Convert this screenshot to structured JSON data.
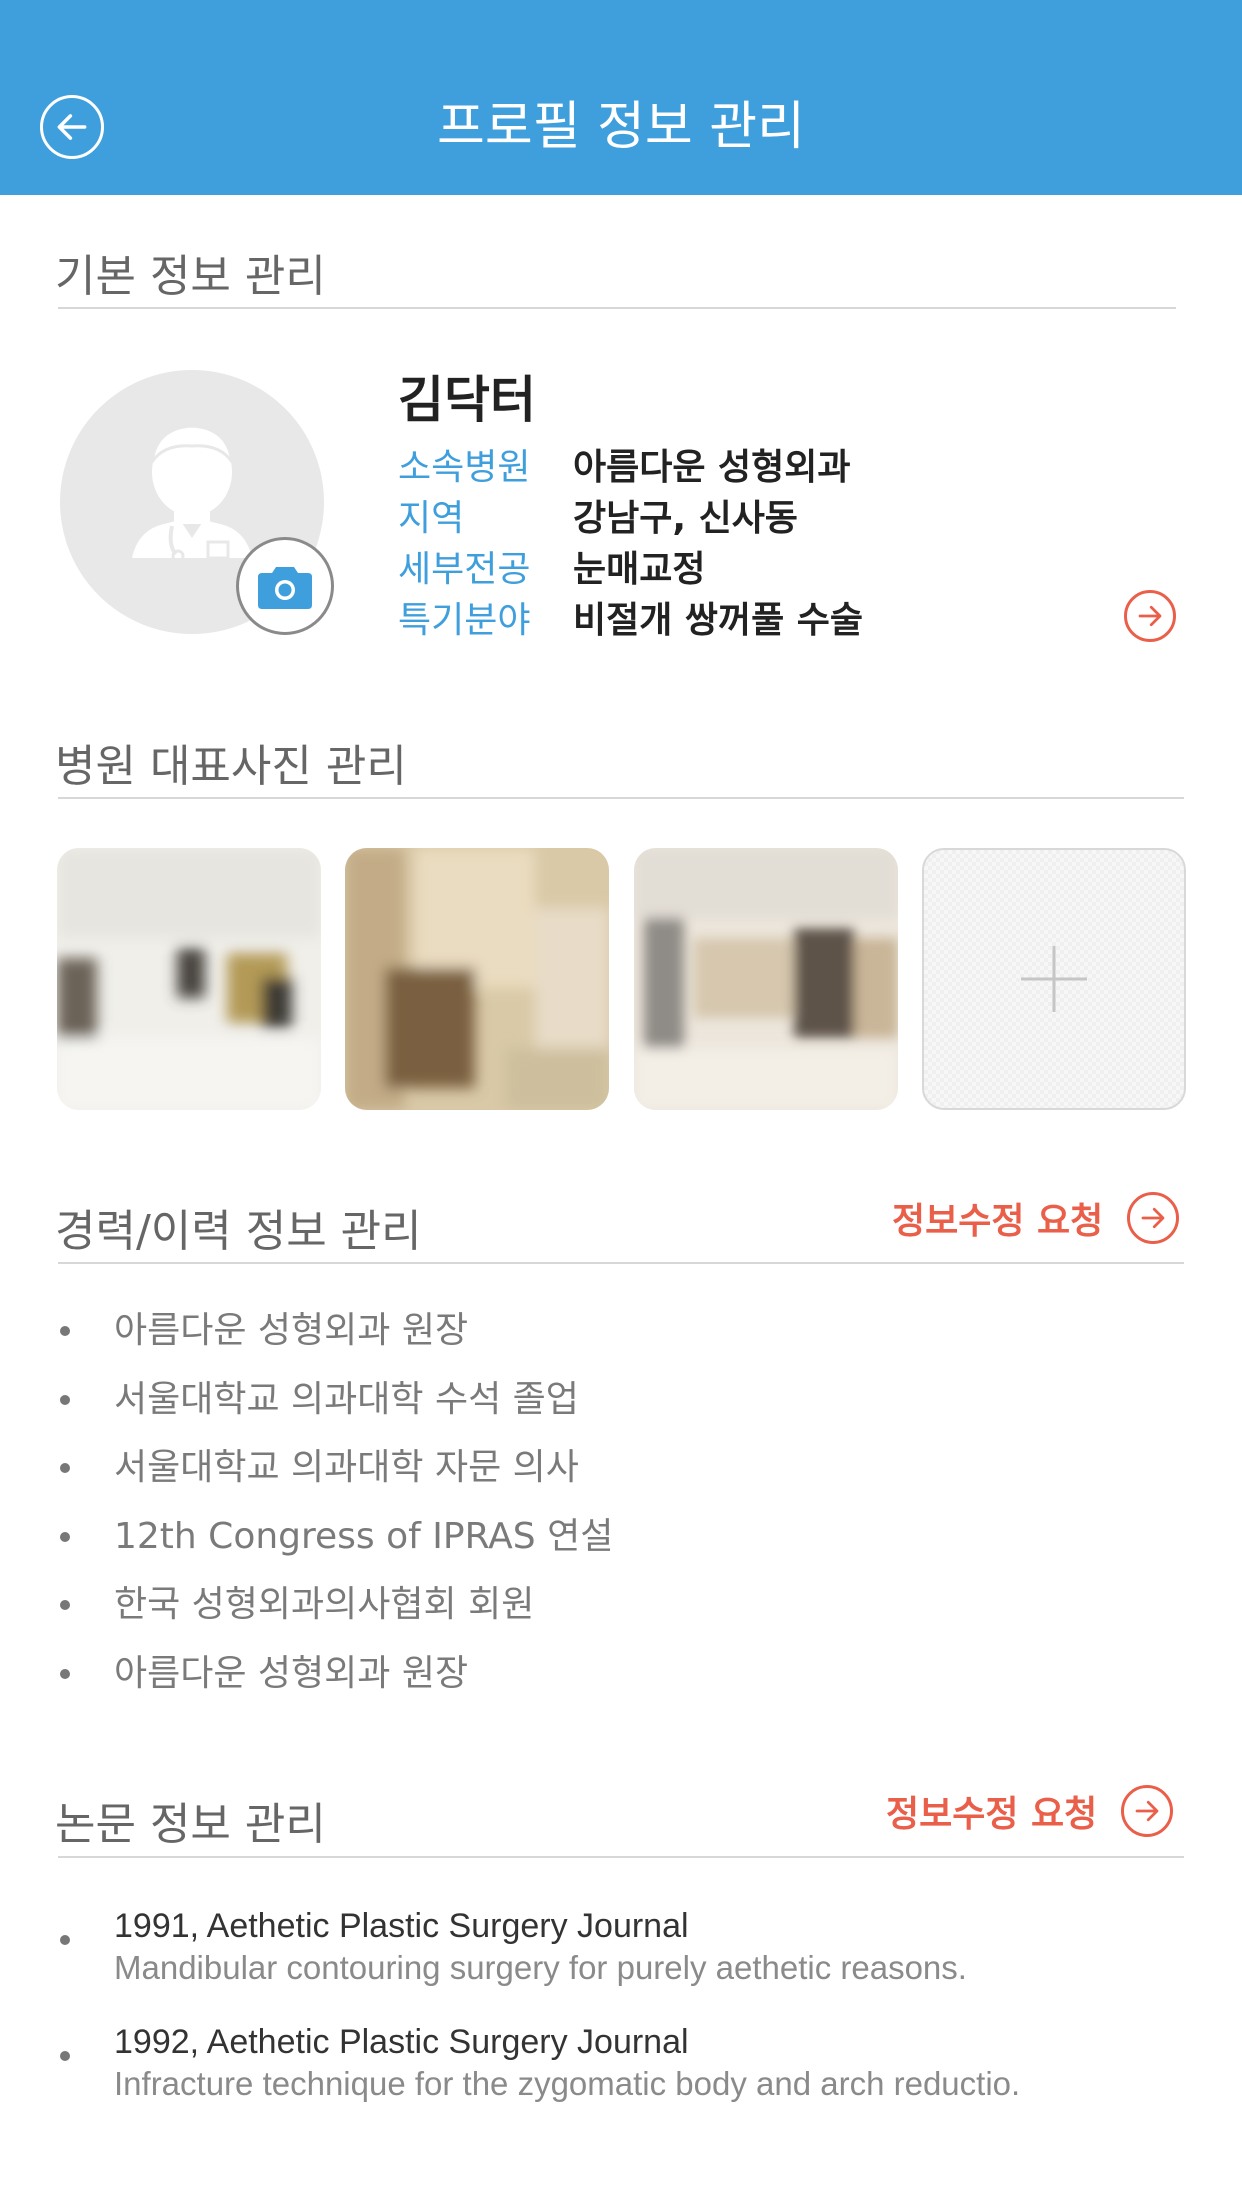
{
  "header": {
    "title": "프로필 정보 관리",
    "back_icon": "arrow-left-circle-icon"
  },
  "basic_info": {
    "section_title": "기본 정보 관리",
    "name": "김닥터",
    "rows": [
      {
        "label": "소속병원",
        "value": "아름다운 성형외과"
      },
      {
        "label": "지역",
        "value": "강남구, 신사동"
      },
      {
        "label": "세부전공",
        "value": "눈매교정"
      },
      {
        "label": "특기분야",
        "value": "비절개 쌍꺼풀 수술"
      }
    ],
    "camera_icon": "camera-icon",
    "edit_icon": "arrow-right-circle-icon"
  },
  "photos": {
    "section_title": "병원 대표사진 관리",
    "add_icon": "plus-icon"
  },
  "career": {
    "section_title": "경력/이력 정보 관리",
    "edit_label": "정보수정 요청",
    "items": [
      "아름다운 성형외과 원장",
      "서울대학교 의과대학 수석 졸업",
      "서울대학교 의과대학 자문 의사",
      "12th Congress of IPRAS 연설",
      "한국 성형외과의사협회 회원",
      "아름다운 성형외과 원장"
    ]
  },
  "papers": {
    "section_title": "논문 정보 관리",
    "edit_label": "정보수정 요청",
    "items": [
      {
        "head": "1991, Aethetic Plastic Surgery Journal",
        "desc": "Mandibular contouring surgery for purely aethetic reasons."
      },
      {
        "head": "1992, Aethetic Plastic Surgery Journal",
        "desc": "Infracture technique for the zygomatic body and arch reductio."
      }
    ]
  },
  "colors": {
    "primary": "#3f9fdd",
    "accent": "#ea5f49"
  }
}
